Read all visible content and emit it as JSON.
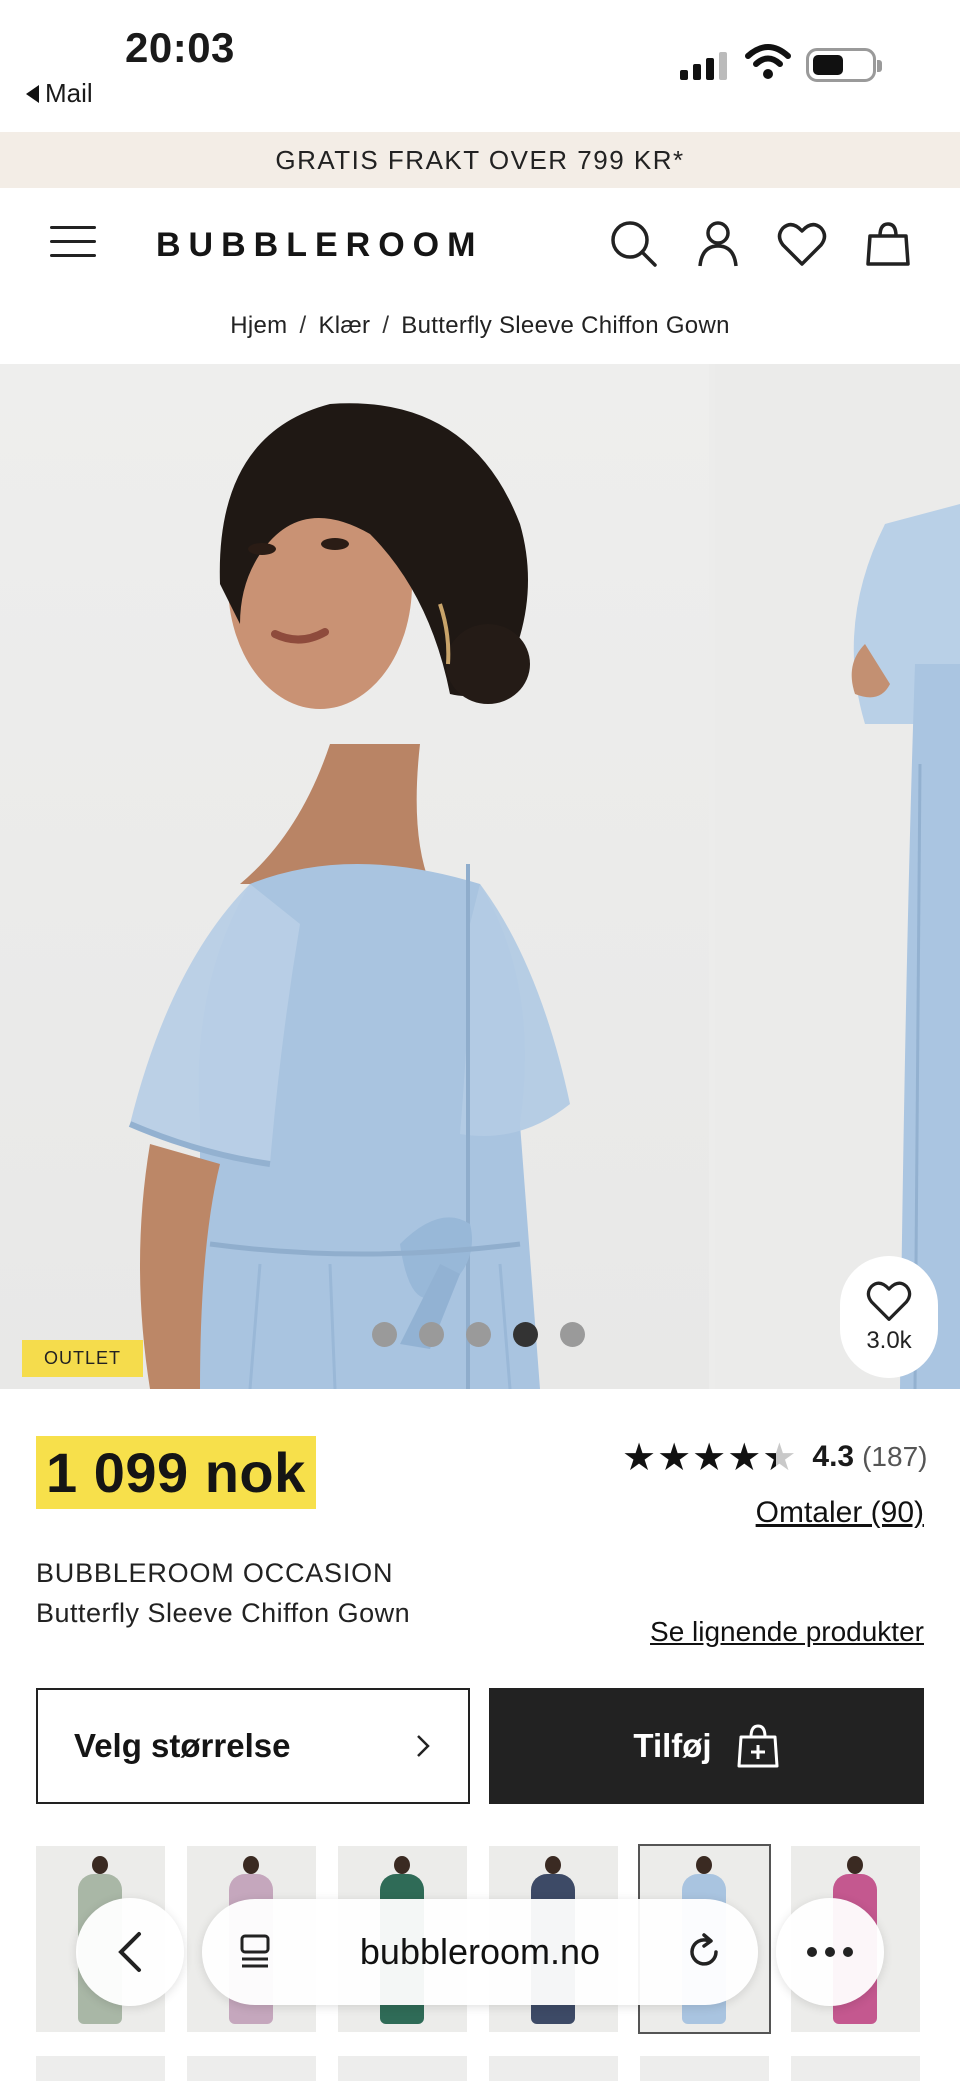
{
  "status_bar": {
    "time": "20:03",
    "back_app": "Mail"
  },
  "promo": {
    "text": "GRATIS FRAKT OVER 799 KR*"
  },
  "header": {
    "logo": "BUBBLEROOM",
    "icons": [
      "menu-icon",
      "search-icon",
      "account-icon",
      "wishlist-icon",
      "cart-icon"
    ]
  },
  "breadcrumb": {
    "items": [
      "Hjem",
      "Klær",
      "Butterfly Sleeve Chiffon Gown"
    ],
    "separator": "/"
  },
  "gallery": {
    "badge": "OUTLET",
    "slide_count": 5,
    "active_slide": 4,
    "favorite_count": "3.0k"
  },
  "product": {
    "price": "1 099 nok",
    "rating_value": "4.3",
    "rating_count": "(187)",
    "rating_stars": 4.3,
    "reviews_link": "Omtaler (90)",
    "brand": "BUBBLEROOM OCCASION",
    "name": "Butterfly Sleeve Chiffon Gown",
    "similar_link": "Se lignende produkter",
    "size_button": "Velg størrelse",
    "add_button": "Tilføj"
  },
  "colors": {
    "price_highlight": "#f7e04b",
    "promo_bg": "#f3ede6",
    "add_button_bg": "#222222",
    "dress_color": "#a9c4e0"
  },
  "thumbnails": [
    {
      "color": "#a9b7a6",
      "selected": false
    },
    {
      "color": "#c5a7bd",
      "selected": false
    },
    {
      "color": "#2f6b57",
      "selected": false
    },
    {
      "color": "#3d4a66",
      "selected": false
    },
    {
      "color": "#a9c4e0",
      "selected": true
    },
    {
      "color": "#c4588f",
      "selected": false
    }
  ],
  "browser": {
    "url": "bubbleroom.no"
  }
}
